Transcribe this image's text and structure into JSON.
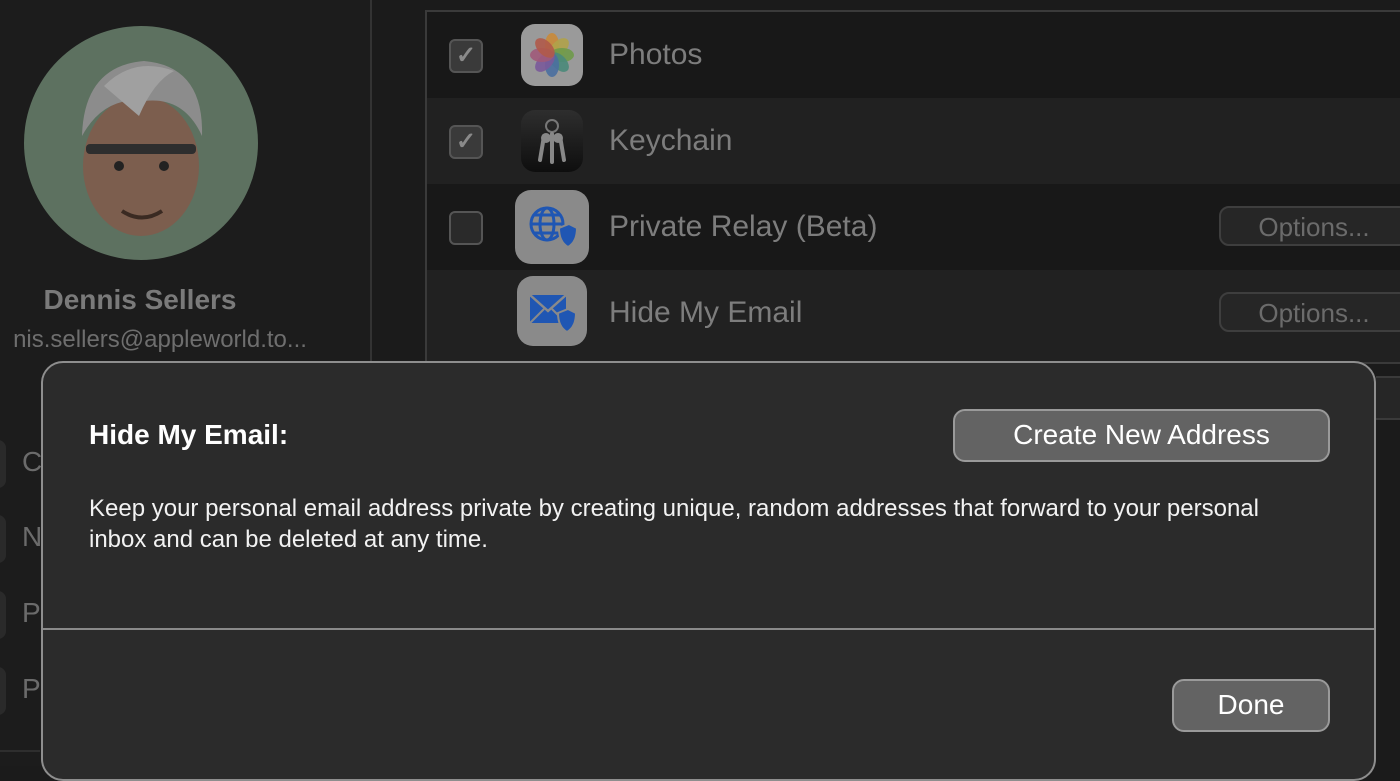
{
  "profile": {
    "name": "Dennis Sellers",
    "email": "nis.sellers@appleworld.to..."
  },
  "sidebar": {
    "items": [
      {
        "letter": "C"
      },
      {
        "letter": "N"
      },
      {
        "letter": "P"
      },
      {
        "letter": "P"
      }
    ]
  },
  "apps": [
    {
      "label": "Photos",
      "checked": true,
      "icon": "photos-icon",
      "check_glyph": "✓"
    },
    {
      "label": "Keychain",
      "checked": true,
      "icon": "keychain-icon",
      "check_glyph": "✓"
    },
    {
      "label": "Private Relay (Beta)",
      "checked": false,
      "icon": "private-relay-icon",
      "options_label": "Options..."
    },
    {
      "label": "Hide My Email",
      "icon": "hide-my-email-icon",
      "options_label": "Options..."
    }
  ],
  "dialog": {
    "title": "Hide My Email:",
    "description": "Keep your personal email address private by creating unique, random addresses that forward to your personal inbox and can be deleted at any time.",
    "create_button": "Create New Address",
    "done_button": "Done"
  },
  "colors": {
    "avatar_bg": "#5d7160",
    "icon_blue": "#1f56b3",
    "dialog_bg": "#2b2b2b",
    "button_bg": "#636363"
  }
}
